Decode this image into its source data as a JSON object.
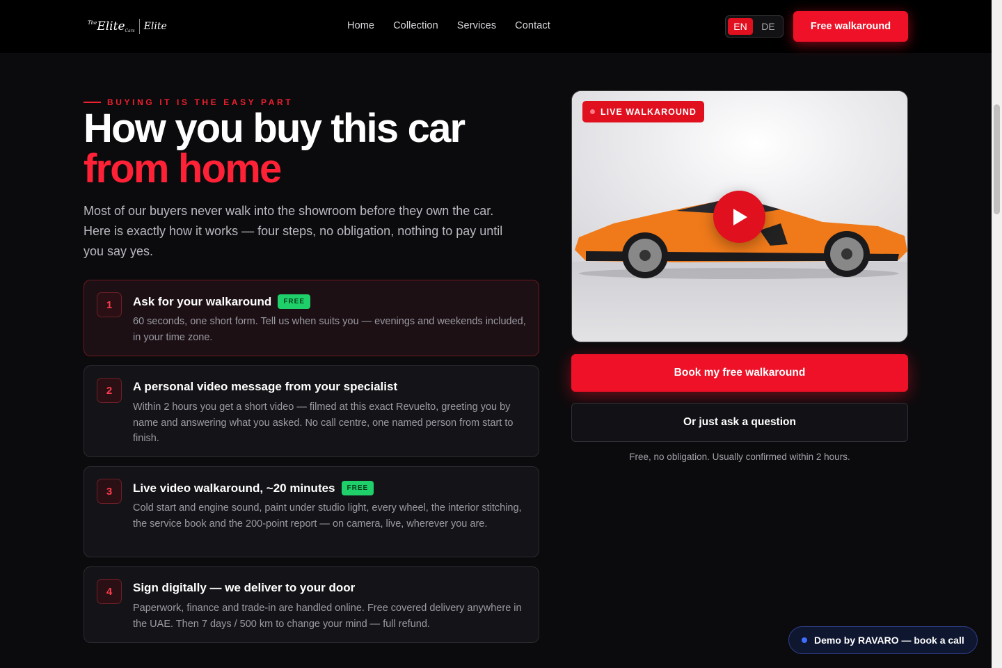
{
  "header": {
    "logo": {
      "the": "The",
      "name": "Elite",
      "cars": "Cars",
      "signature": "Elite"
    },
    "nav": [
      "Home",
      "Collection",
      "Services",
      "Contact"
    ],
    "lang": {
      "active": "EN",
      "inactive": "DE"
    },
    "cta": "Free walkaround"
  },
  "hero": {
    "eyebrow": "BUYING IT IS THE EASY PART",
    "headline_line1": "How you buy this car",
    "headline_line2": "from home",
    "lead": "Most of our buyers never walk into the showroom before they own the car. Here is exactly how it works — four steps, no obligation, nothing to pay until you say yes."
  },
  "steps": [
    {
      "num": "1",
      "title": "Ask for your walkaround",
      "badge": "FREE",
      "desc": "60 seconds, one short form. Tell us when suits you — evenings and weekends included, in your time zone."
    },
    {
      "num": "2",
      "title": "A personal video message from your specialist",
      "badge": "",
      "desc": "Within 2 hours you get a short video — filmed at this exact Revuelto, greeting you by name and answering what you asked. No call centre, one named person from start to finish."
    },
    {
      "num": "3",
      "title": "Live video walkaround, ~20 minutes",
      "badge": "FREE",
      "desc": "Cold start and engine sound, paint under studio light, every wheel, the interior stitching, the service book and the 200-point report — on camera, live, wherever you are."
    },
    {
      "num": "4",
      "title": "Sign digitally — we deliver to your door",
      "badge": "",
      "desc": "Paperwork, finance and trade-in are handled online. Free covered delivery anywhere in the UAE. Then 7 days / 500 km to change your mind — full refund."
    }
  ],
  "video": {
    "badge": "LIVE WALKAROUND"
  },
  "actions": {
    "book": "Book my free walkaround",
    "question": "Or just ask a question",
    "note": "Free, no obligation. Usually confirmed within 2 hours."
  },
  "demo": {
    "label": "Demo by RAVARO — book a call"
  },
  "colors": {
    "accent": "#ee1127",
    "background": "#0b0b0d",
    "free_badge": "#1fd06a"
  }
}
